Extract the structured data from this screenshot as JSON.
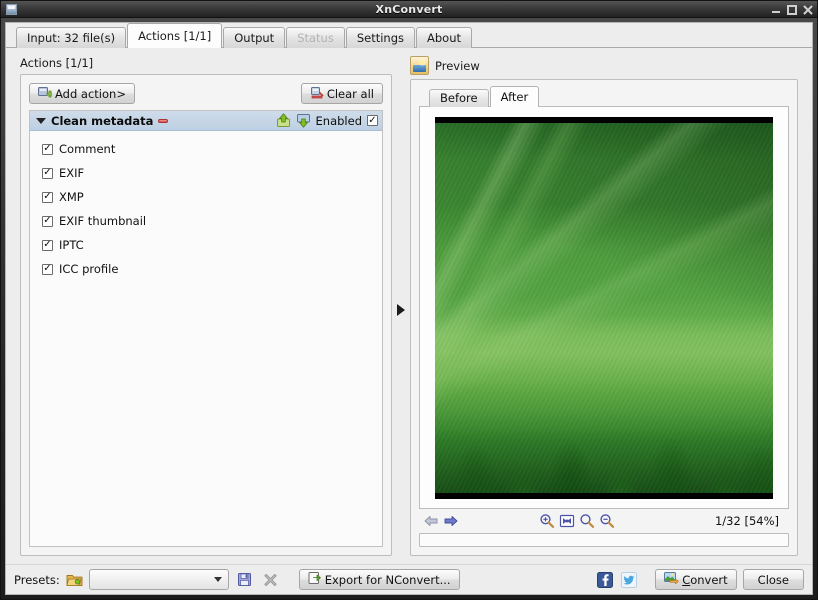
{
  "window": {
    "title": "XnConvert",
    "icon": "app-window-icon",
    "controls": [
      {
        "name": "minimize-button",
        "glyph": "minimize"
      },
      {
        "name": "maximize-button",
        "glyph": "maximize"
      },
      {
        "name": "close-button",
        "glyph": "close"
      }
    ]
  },
  "tabs": [
    {
      "label": "Input: 32 file(s)",
      "name": "tab-input",
      "active": false,
      "disabled": false
    },
    {
      "label": "Actions [1/1]",
      "name": "tab-actions",
      "active": true,
      "disabled": false
    },
    {
      "label": "Output",
      "name": "tab-output",
      "active": false,
      "disabled": false
    },
    {
      "label": "Status",
      "name": "tab-status",
      "active": false,
      "disabled": true
    },
    {
      "label": "Settings",
      "name": "tab-settings",
      "active": false,
      "disabled": false
    },
    {
      "label": "About",
      "name": "tab-about",
      "active": false,
      "disabled": false
    }
  ],
  "actions": {
    "caption": "Actions [1/1]",
    "add_button_label": "Add action>",
    "add_button_icon": "add-action-icon",
    "clear_button_label": "Clear all",
    "clear_button_icon": "clear-all-icon",
    "item": {
      "title": "Clean metadata",
      "remove_icon": "remove-action-icon",
      "move_up_icon": "move-up-icon",
      "move_down_icon": "move-down-icon",
      "enabled_label": "Enabled",
      "enabled_checked": true,
      "expanded": true
    },
    "options": [
      {
        "label": "Comment",
        "checked": true,
        "name": "option-comment"
      },
      {
        "label": "EXIF",
        "checked": true,
        "name": "option-exif"
      },
      {
        "label": "XMP",
        "checked": true,
        "name": "option-xmp"
      },
      {
        "label": "EXIF thumbnail",
        "checked": true,
        "name": "option-exif-thumbnail"
      },
      {
        "label": "IPTC",
        "checked": true,
        "name": "option-iptc"
      },
      {
        "label": "ICC profile",
        "checked": true,
        "name": "option-icc-profile"
      }
    ]
  },
  "splitter": {
    "icon": "collapse-arrow-icon"
  },
  "preview": {
    "title": "Preview",
    "icon": "preview-image-icon",
    "tabs": [
      {
        "label": "Before",
        "name": "preview-tab-before",
        "active": false
      },
      {
        "label": "After",
        "name": "preview-tab-after",
        "active": true
      }
    ],
    "image_alt": "green-field-photo",
    "toolbar": {
      "prev_icon": "previous-image-icon",
      "next_icon": "next-image-icon",
      "zoom_in_icon": "zoom-in-icon",
      "zoom_fit_icon": "zoom-fit-icon",
      "zoom_actual_icon": "zoom-actual-size-icon",
      "zoom_out_icon": "zoom-out-icon",
      "status": "1/32 [54%]"
    }
  },
  "bottom": {
    "presets_label": "Presets:",
    "presets_folder_icon": "open-preset-folder-icon",
    "presets_value": "",
    "presets_placeholder": "",
    "save_icon": "save-preset-icon",
    "delete_icon": "delete-preset-icon",
    "export_label": "Export for NConvert...",
    "export_icon": "export-nconvert-icon",
    "facebook_icon": "facebook-icon",
    "twitter_icon": "twitter-icon",
    "convert_label": "Convert",
    "convert_icon": "convert-icon",
    "close_label": "Close"
  },
  "colors": {
    "titlebar_text": "#e9e9e9",
    "selection_blue": "#c3d5e8",
    "accent_green": "#53a241",
    "disabled_text": "#b3b3b3"
  }
}
